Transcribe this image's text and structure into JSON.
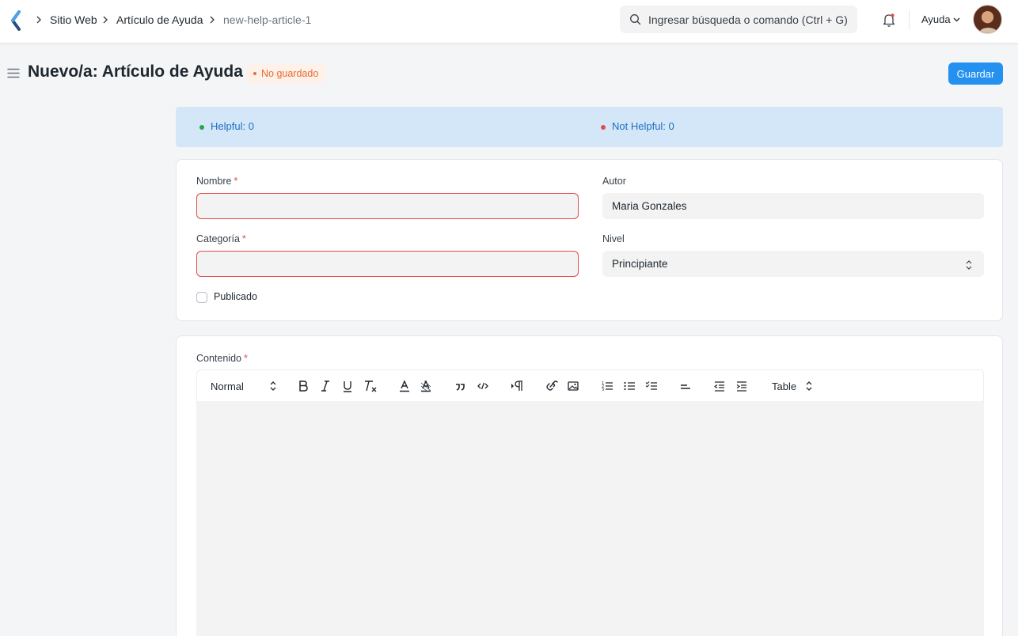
{
  "navbar": {
    "breadcrumbs": [
      {
        "label": "Sitio Web"
      },
      {
        "label": "Artículo de Ayuda"
      },
      {
        "label": "new-help-article-1"
      }
    ],
    "search_placeholder": "Ingresar búsqueda o comando (Ctrl + G)",
    "help_label": "Ayuda"
  },
  "page": {
    "title": "Nuevo/a: Artículo de Ayuda",
    "status": "No guardado",
    "save_label": "Guardar"
  },
  "feedback": {
    "helpful": "Helpful: 0",
    "not_helpful": "Not Helpful: 0"
  },
  "form": {
    "name_label": "Nombre",
    "name_value": "",
    "author_label": "Autor",
    "author_value": "Maria Gonzales",
    "category_label": "Categoría",
    "category_value": "",
    "level_label": "Nivel",
    "level_value": "Principiante",
    "published_label": "Publicado",
    "required_mark": "*"
  },
  "editor": {
    "label": "Contenido",
    "format_value": "Normal",
    "table_label": "Table"
  },
  "colors": {
    "primary": "#2490ef",
    "error": "#e24c4c",
    "warning": "#e86c2c",
    "helpful": "#28a745",
    "not_helpful": "#e24c4c",
    "banner": "#d4e7f9"
  }
}
